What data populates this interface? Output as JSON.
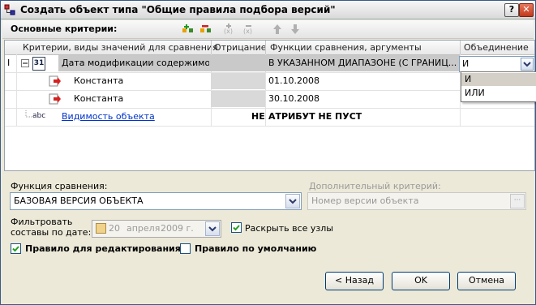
{
  "window": {
    "title": "Создать объект типа \"Общие правила подбора версий\"",
    "help_label": "?",
    "close_label": "✕"
  },
  "toolbar": {
    "label": "Основные критерии:",
    "icons": [
      "add-criterion-icon",
      "delete-criterion-icon",
      "add-argument-icon",
      "remove-argument-icon",
      "move-up-icon",
      "move-down-icon"
    ]
  },
  "grid": {
    "columns": [
      "Критерии, виды значений для сравнения",
      "Отрицание",
      "Функции сравнения, аргументы",
      "Объединение"
    ],
    "rows": [
      {
        "marker": "I",
        "type_badge": "31",
        "criterion": "Дата модификации содержимог...",
        "negation": "",
        "function": "В УКАЗАННОМ ДИАПАЗОНЕ (С ГРАНИЦ...",
        "union": "И"
      },
      {
        "marker": "",
        "type_badge": "",
        "criterion": "Константа",
        "negation": "",
        "function": "01.10.2008",
        "union": ""
      },
      {
        "marker": "",
        "type_badge": "",
        "criterion": "Константа",
        "negation": "",
        "function": "30.10.2008",
        "union": ""
      },
      {
        "marker": "",
        "type_badge": "abc",
        "criterion": "Видимость объекта",
        "negation": "НЕ",
        "function": "АТРИБУТ НЕ ПУСТ",
        "union": ""
      }
    ],
    "union_options": [
      "И",
      "ИЛИ"
    ]
  },
  "form": {
    "compare_func_label": "Функция сравнения:",
    "compare_func_value": "БАЗОВАЯ ВЕРСИЯ ОБЪЕКТА",
    "extra_label": "Дополнительный критерий:",
    "extra_value": "Номер версии объекта",
    "extra_btn": "···",
    "filter_label_1": "Фильтровать",
    "filter_label_2": "составы по дате:",
    "date_day": "20",
    "date_month": "апреля",
    "date_year": "2009 г.",
    "expand_all_label": "Раскрыть все узлы",
    "expand_all_checked": true,
    "edit_rule_label": "Правило для редактирования",
    "edit_rule_checked": true,
    "default_rule_label": "Правило по умолчанию",
    "default_rule_checked": false
  },
  "buttons": {
    "back": "< Назад",
    "ok": "OK",
    "cancel": "Отмена"
  },
  "colors": {
    "accent": "#1a7a1a",
    "link": "#0033cc",
    "selected_row": "#c9c9c9"
  }
}
